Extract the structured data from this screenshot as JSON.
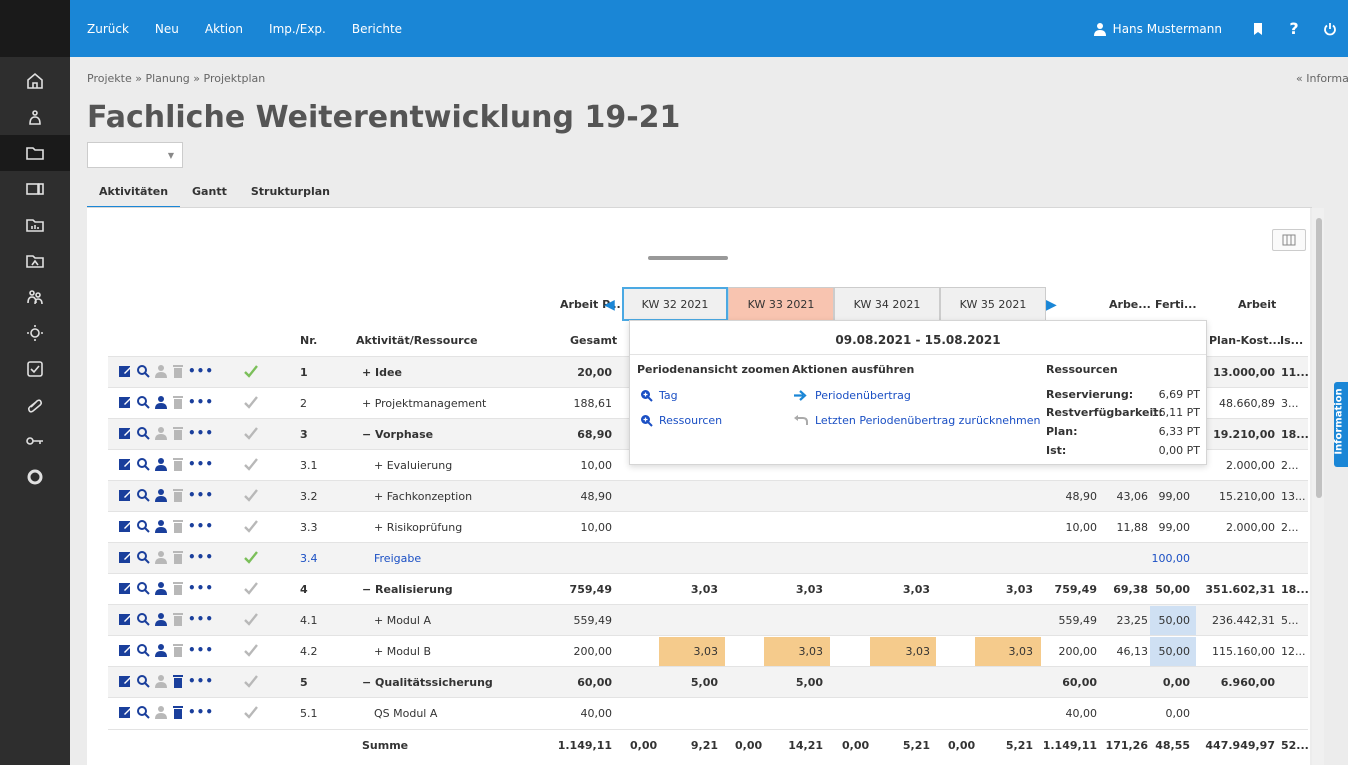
{
  "nav": {
    "items": [
      "Zurück",
      "Neu",
      "Aktion",
      "Imp./Exp.",
      "Berichte"
    ],
    "user_name": "Hans Mustermann",
    "help_label": "?"
  },
  "breadcrumb": "Projekte » Planung » Projektplan",
  "info_link": "« Information",
  "page_title": "Fachliche Weiterentwicklung 19-21",
  "tabs": [
    "Aktivitäten",
    "Gantt",
    "Strukturplan"
  ],
  "header": {
    "group_left": "Arbeit P...",
    "group_arbe": "Arbe...",
    "group_ferti": "Ferti...",
    "group_arbeit": "Arbeit",
    "col_nr": "Nr.",
    "col_activity": "Aktivität/Ressource",
    "col_gesamt": "Gesamt",
    "col_plankost": "Plan-Kost...",
    "col_is": "Is..."
  },
  "weeks": [
    "KW 32 2021",
    "KW 33 2021",
    "KW 34 2021",
    "KW 35 2021"
  ],
  "rows": [
    {
      "nr": "1",
      "name": "+ Idee",
      "gesamt": "20,00",
      "plan": "13.000,00",
      "is": "11..."
    },
    {
      "nr": "2",
      "name": "+ Projektmanagement",
      "gesamt": "188,61",
      "plan": "48.660,89",
      "is": "3..."
    },
    {
      "nr": "3",
      "name": "− Vorphase",
      "gesamt": "68,90",
      "plan": "19.210,00",
      "is": "18..."
    },
    {
      "nr": "3.1",
      "name": "+ Evaluierung",
      "gesamt": "10,00",
      "plan": "2.000,00",
      "is": "2..."
    },
    {
      "nr": "3.2",
      "name": "+ Fachkonzeption",
      "gesamt": "48,90",
      "a": "48,90",
      "b": "43,06",
      "c": "99,00",
      "plan": "15.210,00",
      "is": "13..."
    },
    {
      "nr": "3.3",
      "name": "+ Risikoprüfung",
      "gesamt": "10,00",
      "a": "10,00",
      "b": "11,88",
      "c": "99,00",
      "plan": "2.000,00",
      "is": "2..."
    },
    {
      "nr": "3.4",
      "name": "Freigabe",
      "c": "100,00"
    },
    {
      "nr": "4",
      "name": "− Realisierung",
      "gesamt": "759,49",
      "w1": "3,03",
      "w2": "3,03",
      "w3": "3,03",
      "w4": "3,03",
      "a": "759,49",
      "b": "69,38",
      "c": "50,00",
      "plan": "351.602,31",
      "is": "18..."
    },
    {
      "nr": "4.1",
      "name": "+ Modul A",
      "gesamt": "559,49",
      "a": "559,49",
      "b": "23,25",
      "c": "50,00",
      "plan": "236.442,31",
      "is": "5..."
    },
    {
      "nr": "4.2",
      "name": "+ Modul B",
      "gesamt": "200,00",
      "w1": "3,03",
      "w2": "3,03",
      "w3": "3,03",
      "w4": "3,03",
      "a": "200,00",
      "b": "46,13",
      "c": "50,00",
      "plan": "115.160,00",
      "is": "12..."
    },
    {
      "nr": "5",
      "name": "− Qualitätssicherung",
      "gesamt": "60,00",
      "w1": "5,00",
      "w2": "5,00",
      "a": "60,00",
      "c": "0,00",
      "plan": "6.960,00"
    },
    {
      "nr": "5.1",
      "name": "QS Modul A",
      "gesamt": "40,00",
      "a": "40,00",
      "c": "0,00"
    }
  ],
  "summe": {
    "label": "Summe",
    "gesamt": "1.149,11",
    "v1": "0,00",
    "v2": "9,21",
    "v3": "0,00",
    "v4": "14,21",
    "v5": "0,00",
    "v6": "5,21",
    "v7": "0,00",
    "v8": "5,21",
    "a": "1.149,11",
    "b": "171,26",
    "c": "48,55",
    "plan": "447.949,97",
    "is": "52..."
  },
  "popup": {
    "title": "09.08.2021 - 15.08.2021",
    "zoom_head": "Periodenansicht zoomen",
    "zoom_tag": "Tag",
    "zoom_res": "Ressourcen",
    "action_head": "Aktionen ausführen",
    "action_1": "Periodenübertrag",
    "action_2": "Letzten Periodenübertrag zurücknehmen",
    "res_head": "Ressourcen",
    "res_labels": [
      "Reservierung:",
      "Restverfügbarkeit:",
      "Plan:",
      "Ist:"
    ],
    "res_values": [
      "6,69 PT",
      "16,11 PT",
      "6,33 PT",
      "0,00 PT"
    ]
  },
  "info_tab": "Information",
  "colors": {
    "brand": "#1a86d6",
    "orange": "#f5cb8c",
    "week_highlight": "#f8c4b0",
    "check_green": "#7bbf5a"
  }
}
